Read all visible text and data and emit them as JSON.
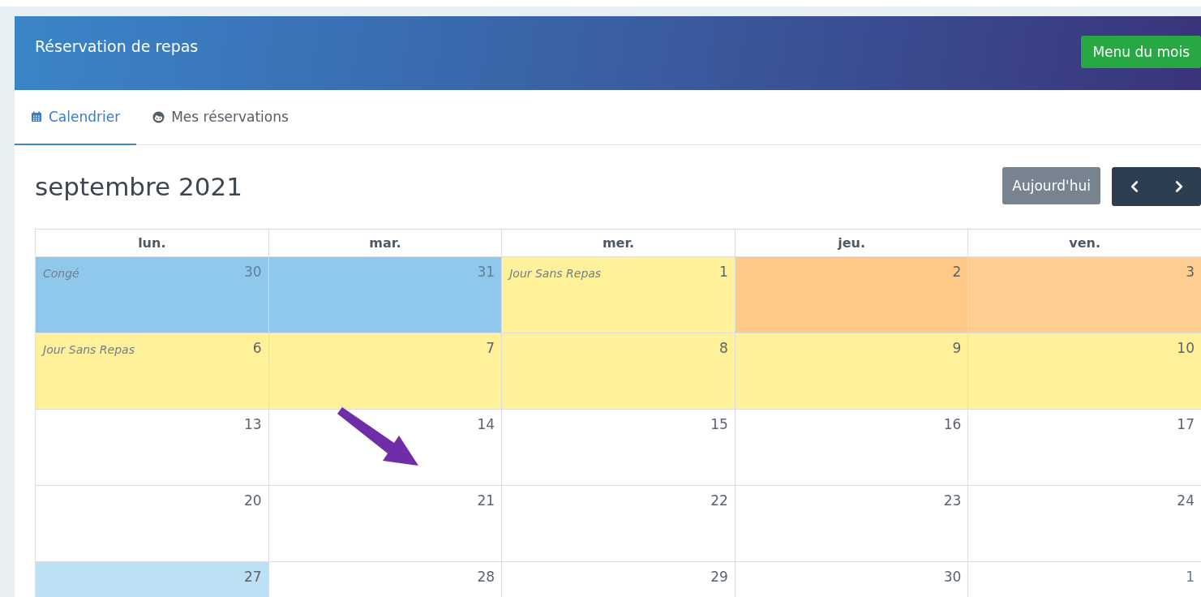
{
  "header": {
    "title": "Réservation de repas",
    "menu_button": "Menu du mois"
  },
  "tabs": [
    {
      "label": "Calendrier",
      "kind": "calendar",
      "selected": true
    },
    {
      "label": "Mes réservations",
      "kind": "face",
      "selected": false
    }
  ],
  "calendar": {
    "title": "septembre 2021",
    "today_button": "Aujourd'hui",
    "weekdays": [
      "lun.",
      "mar.",
      "mer.",
      "jeu.",
      "ven."
    ],
    "weeks": [
      [
        {
          "day": "30",
          "other_month": true,
          "color": "#90c8ec",
          "event": "Congé"
        },
        {
          "day": "31",
          "other_month": true,
          "color": "#90c8ec"
        },
        {
          "day": "1",
          "other_month": false,
          "color": "#fff09a",
          "event": "Jour Sans Repas"
        },
        {
          "day": "2",
          "other_month": false,
          "color": "#fec987"
        },
        {
          "day": "3",
          "other_month": false,
          "color": "#fecd91"
        }
      ],
      [
        {
          "day": "6",
          "other_month": false,
          "color": "#fff09a",
          "event": "Jour Sans Repas"
        },
        {
          "day": "7",
          "other_month": false,
          "color": "#fff09a"
        },
        {
          "day": "8",
          "other_month": false,
          "color": "#fff09a"
        },
        {
          "day": "9",
          "other_month": false,
          "color": "#fff09a"
        },
        {
          "day": "10",
          "other_month": false,
          "color": "#fff09a"
        }
      ],
      [
        {
          "day": "13",
          "other_month": false
        },
        {
          "day": "14",
          "other_month": false
        },
        {
          "day": "15",
          "other_month": false
        },
        {
          "day": "16",
          "other_month": false
        },
        {
          "day": "17",
          "other_month": false
        }
      ],
      [
        {
          "day": "20",
          "other_month": false
        },
        {
          "day": "21",
          "other_month": false
        },
        {
          "day": "22",
          "other_month": false
        },
        {
          "day": "23",
          "other_month": false
        },
        {
          "day": "24",
          "other_month": false
        }
      ],
      [
        {
          "day": "27",
          "other_month": false,
          "color": "#bde0f4"
        },
        {
          "day": "28",
          "other_month": false
        },
        {
          "day": "29",
          "other_month": false
        },
        {
          "day": "30",
          "other_month": false
        },
        {
          "day": "1",
          "other_month": true
        }
      ]
    ]
  }
}
